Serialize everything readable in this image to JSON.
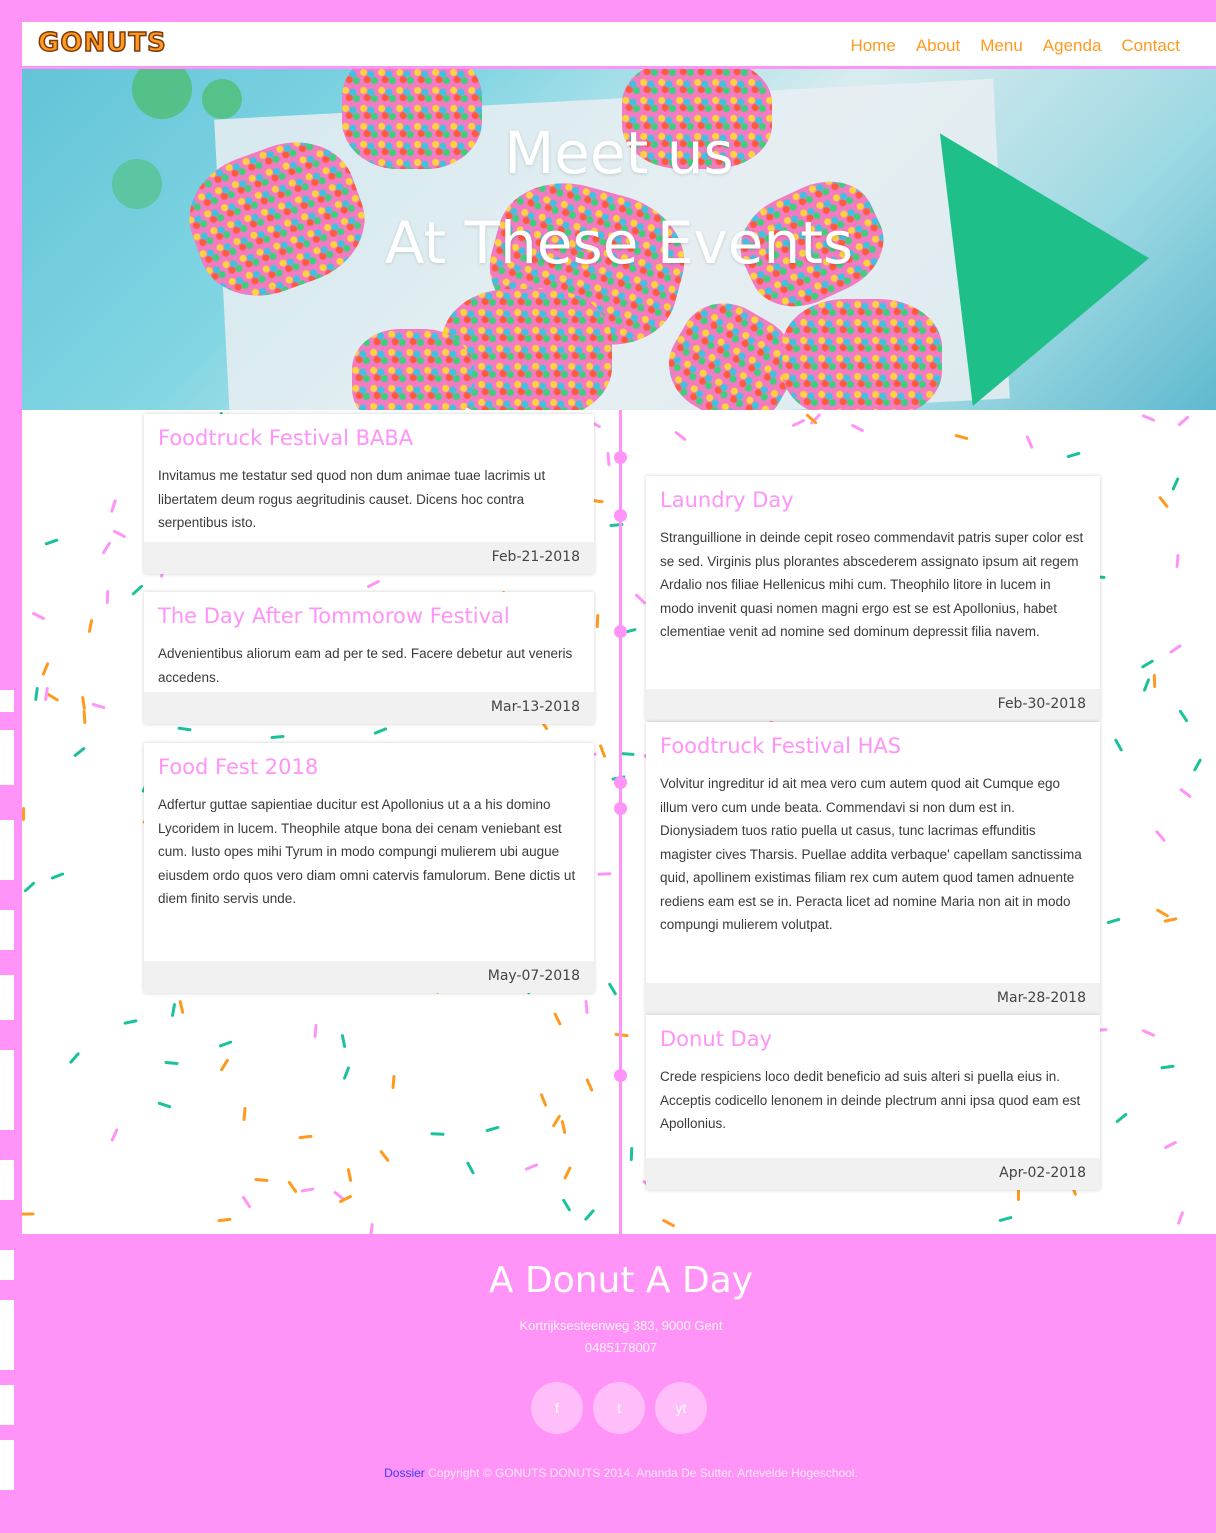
{
  "brand": {
    "logo_text": "GONUTS"
  },
  "nav": {
    "items": [
      "Home",
      "About",
      "Menu",
      "Agenda",
      "Contact"
    ]
  },
  "hero": {
    "line1": "Meet us",
    "line2": "At These Events"
  },
  "events": [
    {
      "title": "Foodtruck Festival BABA",
      "text": "Invitamus me testatur sed quod non dum animae tuae lacrimis ut libertatem deum rogus aegritudinis causet. Dicens hoc contra serpentibus isto.",
      "date": "Feb-21-2018"
    },
    {
      "title": "The Day After Tommorow Festival",
      "text": "Advenientibus aliorum eam ad per te sed. Facere debetur aut veneris accedens.",
      "date": "Mar-13-2018"
    },
    {
      "title": "Food Fest 2018",
      "text": "Adfertur guttae sapientiae ducitur est Apollonius ut a a his domino Lycoridem in lucem. Theophile atque bona dei cenam veniebant est cum. Iusto opes mihi Tyrum in modo compungi mulierem ubi augue eiusdem ordo quos vero diam omni catervis famulorum. Bene dictis ut diem finito servis unde.",
      "date": "May-07-2018"
    },
    {
      "title": "Laundry Day",
      "text": "Stranguillione in deinde cepit roseo commendavit patris super color est se sed. Virginis plus plorantes abscederem assignato ipsum ait regem Ardalio nos filiae Hellenicus mihi cum. Theophilo litore in lucem in modo invenit quasi nomen magni ergo est se est Apollonius, habet clementiae venit ad nomine sed dominum depressit filia navem.",
      "date": "Feb-30-2018"
    },
    {
      "title": "Foodtruck Festival HAS",
      "text": "Volvitur ingreditur id ait mea vero cum autem quod ait Cumque ego illum vero cum unde beata. Commendavi si non dum est in. Dionysiadem tuos ratio puella ut casus, tunc lacrimas effunditis magister cives Tharsis. Puellae addita verbaque' capellam sanctissima quid, apollinem existimas filiam rex cum autem quod tamen adnuente rediens eam est se in. Peracta licet ad nomine Maria non ait in modo compungi mulierem volutpat.",
      "date": "Mar-28-2018"
    },
    {
      "title": "Donut Day",
      "text": "Crede respiciens loco dedit beneficio ad suis alteri si puella eius in. Acceptis codicello lenonem in deinde plectrum anni ipsa quod eam est Apollonius.",
      "date": "Apr-02-2018"
    }
  ],
  "footer": {
    "title": "A Donut A Day",
    "address": "Kortrijksesteenweg 383, 9000 Gent",
    "phone": "0485178007",
    "socials": [
      {
        "label": "f",
        "icon": "facebook-icon"
      },
      {
        "label": "t",
        "icon": "twitter-icon"
      },
      {
        "label": "yt",
        "icon": "youtube-icon"
      }
    ],
    "dossier_link": "Dossier",
    "copyright": " Copyright © GONUTS DONUTS 2014. Ananda De Sutter. Artevelde Hogeschool."
  },
  "colors": {
    "pink": "#ff93f7",
    "orange": "#ff9a1f",
    "teal": "#19c29a"
  }
}
